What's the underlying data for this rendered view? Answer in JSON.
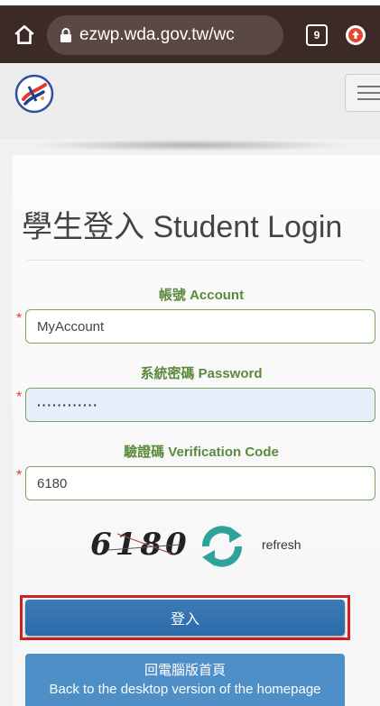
{
  "browser": {
    "url": "ezwp.wda.gov.tw/wc",
    "tab_count": "9"
  },
  "page": {
    "title": "學生登入 Student Login",
    "account_label": "帳號 Account",
    "account_value": "MyAccount",
    "password_label": "系統密碼 Password",
    "password_value": "············",
    "verification_label": "驗證碼 Verification Code",
    "verification_value": "6180",
    "required_mark": "*",
    "captcha_text": "6180",
    "refresh_label": "refresh",
    "login_button": "登入",
    "back_button_line1": "回電腦版首頁",
    "back_button_line2": "Back to the desktop version of the homepage"
  },
  "colors": {
    "browser_chrome": "#3b2a26",
    "label_green": "#5b8a3c",
    "button_blue": "#2f6fae",
    "required_red": "#e53935",
    "highlight_red": "#d12020",
    "refresh_green": "#2ea39a"
  },
  "icons": {
    "home": "home-icon",
    "lock": "lock-icon",
    "tabs": "tabs-icon",
    "browser_menu": "browser-menu-icon",
    "logo": "site-logo",
    "hamburger": "hamburger-menu-icon",
    "refresh": "refresh-icon"
  }
}
